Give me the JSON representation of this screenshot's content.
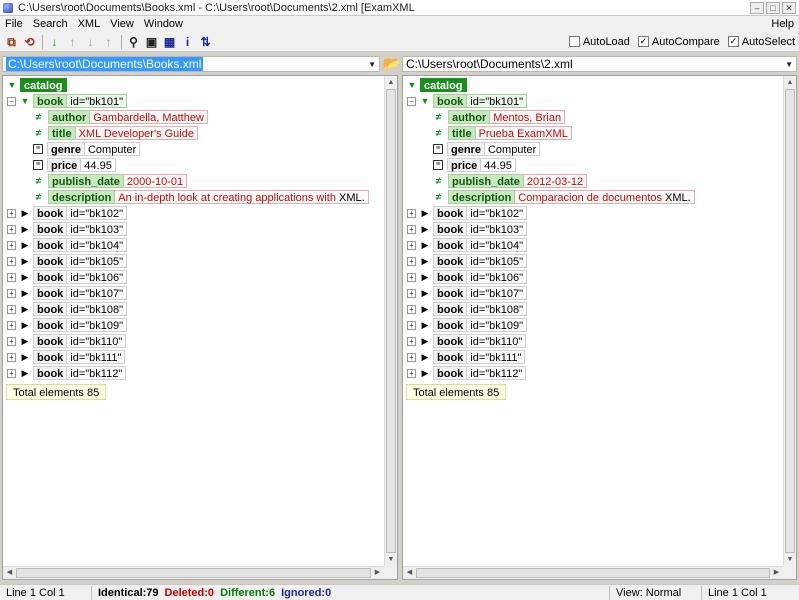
{
  "window": {
    "title": "C:\\Users\\root\\Documents\\Books.xml - C:\\Users\\root\\Documents\\2.xml [ExamXML"
  },
  "menu": {
    "items": [
      "File",
      "Search",
      "XML",
      "View",
      "Window"
    ],
    "help": "Help"
  },
  "toolbar": {
    "icons": [
      "open-files-icon",
      "reload-icon",
      "next-diff-down-icon",
      "prev-diff-up-icon",
      "next-diff-down-gray-icon",
      "prev-diff-up-gray-icon",
      "find-icon",
      "save-icon",
      "table-icon",
      "info-icon",
      "sort-icon"
    ],
    "checkboxes": [
      {
        "label": "AutoLoad",
        "checked": false
      },
      {
        "label": "AutoCompare",
        "checked": true
      },
      {
        "label": "AutoSelect",
        "checked": true
      }
    ]
  },
  "left": {
    "path": "C:\\Users\\root\\Documents\\Books.xml",
    "root": "catalog",
    "book1": {
      "tag": "book",
      "attr": "id=\"bk101\"",
      "children": [
        {
          "tag": "author",
          "value": "Gambardella, Matthew",
          "value_same": "",
          "diff": true
        },
        {
          "tag": "title",
          "value": "XML Developer's Guide",
          "value_same": "",
          "diff": true
        },
        {
          "tag": "genre",
          "value": "",
          "value_same": "Computer",
          "diff": false
        },
        {
          "tag": "price",
          "value": "",
          "value_same": "44.95",
          "diff": false
        },
        {
          "tag": "publish_date",
          "value": "2000-10-01",
          "value_same": "",
          "diff": true
        },
        {
          "tag": "description",
          "value": "An in-depth look at creating applications        with",
          "value_same": " XML.",
          "diff": true
        }
      ]
    },
    "books": [
      {
        "tag": "book",
        "attr": "id=\"bk102\""
      },
      {
        "tag": "book",
        "attr": "id=\"bk103\""
      },
      {
        "tag": "book",
        "attr": "id=\"bk104\""
      },
      {
        "tag": "book",
        "attr": "id=\"bk105\""
      },
      {
        "tag": "book",
        "attr": "id=\"bk106\""
      },
      {
        "tag": "book",
        "attr": "id=\"bk107\""
      },
      {
        "tag": "book",
        "attr": "id=\"bk108\""
      },
      {
        "tag": "book",
        "attr": "id=\"bk109\""
      },
      {
        "tag": "book",
        "attr": "id=\"bk110\""
      },
      {
        "tag": "book",
        "attr": "id=\"bk111\""
      },
      {
        "tag": "book",
        "attr": "id=\"bk112\""
      }
    ],
    "total": "Total elements 85"
  },
  "right": {
    "path": "C:\\Users\\root\\Documents\\2.xml",
    "root": "catalog",
    "book1": {
      "tag": "book",
      "attr": "id=\"bk101\"",
      "children": [
        {
          "tag": "author",
          "value": "Mentos, Brian",
          "value_same": "",
          "diff": true
        },
        {
          "tag": "title",
          "value": "Prueba ExamXML",
          "value_same": "",
          "diff": true
        },
        {
          "tag": "genre",
          "value": "",
          "value_same": "Computer",
          "diff": false
        },
        {
          "tag": "price",
          "value": "",
          "value_same": "44.95",
          "diff": false
        },
        {
          "tag": "publish_date",
          "value": "2012-03-12",
          "value_same": "",
          "diff": true
        },
        {
          "tag": "description",
          "value": "Comparacion de documentos",
          "value_same": " XML.",
          "diff": true
        }
      ]
    },
    "books": [
      {
        "tag": "book",
        "attr": "id=\"bk102\""
      },
      {
        "tag": "book",
        "attr": "id=\"bk103\""
      },
      {
        "tag": "book",
        "attr": "id=\"bk104\""
      },
      {
        "tag": "book",
        "attr": "id=\"bk105\""
      },
      {
        "tag": "book",
        "attr": "id=\"bk106\""
      },
      {
        "tag": "book",
        "attr": "id=\"bk107\""
      },
      {
        "tag": "book",
        "attr": "id=\"bk108\""
      },
      {
        "tag": "book",
        "attr": "id=\"bk109\""
      },
      {
        "tag": "book",
        "attr": "id=\"bk110\""
      },
      {
        "tag": "book",
        "attr": "id=\"bk111\""
      },
      {
        "tag": "book",
        "attr": "id=\"bk112\""
      }
    ],
    "total": "Total elements 85"
  },
  "status": {
    "left_pos": "Line 1  Col 1",
    "identical": "Identical:79",
    "deleted": "Deleted:0",
    "different": "Different:6",
    "ignored": "Ignored:0",
    "view": "View: Normal",
    "right_pos": "Line 1  Col 1"
  },
  "colors": {
    "diff_green": "#1b8d1b",
    "diff_value_red": "#b01010",
    "selection_blue": "#3399ff"
  }
}
